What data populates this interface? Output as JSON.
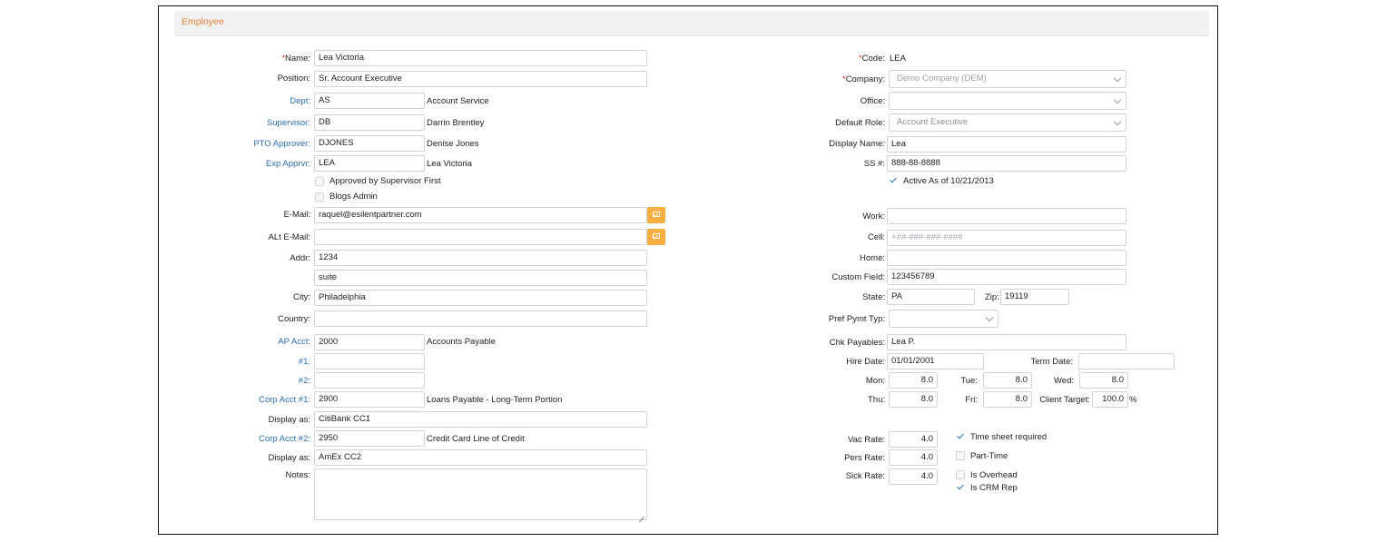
{
  "section_title": "Employee",
  "required_mark": "*",
  "left": {
    "name": {
      "label": "Name:",
      "value": "Lea Victoria"
    },
    "position": {
      "label": "Position:",
      "value": "Sr. Account Executive"
    },
    "dept": {
      "label": "Dept:",
      "value": "AS",
      "desc": "Account Service"
    },
    "supervisor": {
      "label": "Supervisor:",
      "value": "DB",
      "desc": "Darrin Brentley"
    },
    "pto_approver": {
      "label": "PTO Approver:",
      "value": "DJONES",
      "desc": "Denise Jones"
    },
    "exp_apprvr": {
      "label": "Exp Apprvr:",
      "value": "LEA",
      "desc": "Lea Victoria"
    },
    "approved_by_supervisor": {
      "label": "Approved by Supervisor First",
      "checked": false
    },
    "blogs_admin": {
      "label": "Blogs Admin",
      "checked": false
    },
    "email": {
      "label": "E-Mail:",
      "value": "raquel@esilentpartner.com"
    },
    "alt_email": {
      "label": "ALt E-Mail:",
      "value": ""
    },
    "addr": {
      "label": "Addr:",
      "value": "1234",
      "value2": "suite"
    },
    "city": {
      "label": "City:",
      "value": "Philadelphia"
    },
    "country": {
      "label": "Country:",
      "value": ""
    },
    "ap_acct": {
      "label": "AP Acct:",
      "value": "2000",
      "desc": "Accounts Payable"
    },
    "num1": {
      "label": "#1:",
      "value": ""
    },
    "num2": {
      "label": "#2:",
      "value": ""
    },
    "corp_acct1": {
      "label": "Corp Acct #1:",
      "value": "2900",
      "desc": "Loans Payable - Long-Term Portion"
    },
    "display_as1": {
      "label": "Display as:",
      "value": "CitiBank CC1"
    },
    "corp_acct2": {
      "label": "Corp Acct #2:",
      "value": "2950",
      "desc": "Credit Card Line of Credit"
    },
    "display_as2": {
      "label": "Display as:",
      "value": "AmEx CC2"
    },
    "notes": {
      "label": "Notes:",
      "value": ""
    }
  },
  "right": {
    "code": {
      "label": "Code:",
      "value": "LEA"
    },
    "company": {
      "label": "Company:",
      "value": "Demo Company (DEM)"
    },
    "office": {
      "label": "Office:",
      "value": ""
    },
    "default_role": {
      "label": "Default Role:",
      "value": "Account Executive"
    },
    "display_name": {
      "label": "Display Name:",
      "value": "Lea"
    },
    "ss": {
      "label": "SS #:",
      "value": "888-88-8888"
    },
    "active": {
      "label": "Active As of 10/21/2013",
      "checked": true
    },
    "work": {
      "label": "Work:",
      "value": ""
    },
    "cell": {
      "label": "Cell:",
      "placeholder": "+##-###-###-####"
    },
    "home": {
      "label": "Home:",
      "value": ""
    },
    "custom_field": {
      "label": "Custom Field:",
      "value": "123456789"
    },
    "state": {
      "label": "State:",
      "value": "PA"
    },
    "zip": {
      "label": "Zip:",
      "value": "19119"
    },
    "pref_pymt": {
      "label": "Pref Pymt Typ:",
      "value": ""
    },
    "chk_payables": {
      "label": "Chk Payables:",
      "value": "Lea P."
    },
    "hire_date": {
      "label": "Hire Date:",
      "value": "01/01/2001"
    },
    "term_date": {
      "label": "Term Date:",
      "value": ""
    },
    "mon": {
      "label": "Mon:",
      "value": "8.0"
    },
    "tue": {
      "label": "Tue:",
      "value": "8.0"
    },
    "wed": {
      "label": "Wed:",
      "value": "8.0"
    },
    "thu": {
      "label": "Thu:",
      "value": "8.0"
    },
    "fri": {
      "label": "Fri:",
      "value": "8.0"
    },
    "client_target": {
      "label": "Client Target:",
      "value": "100.0",
      "unit": "%"
    },
    "vac_rate": {
      "label": "Vac Rate:",
      "value": "4.0"
    },
    "pers_rate": {
      "label": "Pers Rate:",
      "value": "4.0"
    },
    "sick_rate": {
      "label": "Sick Rate:",
      "value": "4.0"
    },
    "time_sheet_required": {
      "label": "Time sheet required",
      "checked": true
    },
    "part_time": {
      "label": "Part-Time",
      "checked": false
    },
    "is_overhead": {
      "label": "Is Overhead",
      "checked": false
    },
    "is_crm_rep": {
      "label": "Is CRM Rep",
      "checked": true
    }
  }
}
